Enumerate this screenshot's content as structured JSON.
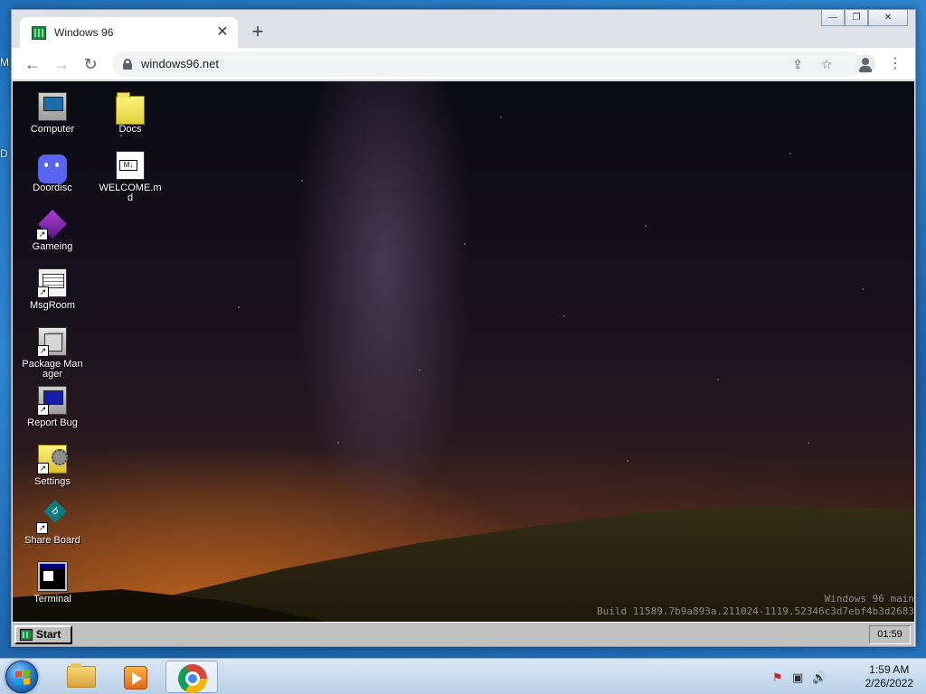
{
  "host_edge": {
    "top_letter": "M",
    "mid_letter": "D"
  },
  "browser": {
    "tab_title": "Windows 96",
    "tab_close": "✕",
    "new_tab": "+",
    "window_controls": {
      "minimize": "—",
      "restore": "❐",
      "close": "✕"
    },
    "nav": {
      "back": "←",
      "forward": "→",
      "reload": "↻"
    },
    "url": "windows96.net",
    "share": "⇪",
    "bookmark": "☆",
    "menu": "⋮"
  },
  "win96": {
    "desktop_icons": [
      {
        "label": "Computer",
        "icon": "computer-icon"
      },
      {
        "label": "Doordisc",
        "icon": "discord-icon"
      },
      {
        "label": "Gameing",
        "icon": "cube-icon"
      },
      {
        "label": "MsgRoom",
        "icon": "msg-icon"
      },
      {
        "label": "Package Manager",
        "icon": "package-icon"
      },
      {
        "label": "Report Bug",
        "icon": "bug-icon"
      },
      {
        "label": "Settings",
        "icon": "settings-icon"
      },
      {
        "label": "Share Board",
        "icon": "board-icon"
      },
      {
        "label": "Terminal",
        "icon": "terminal-icon"
      },
      {
        "label": "Docs",
        "icon": "folder-icon"
      },
      {
        "label": "WELCOME.md",
        "icon": "document-icon"
      }
    ],
    "build_line1": "Windows 96 main",
    "build_line2": "Build 11589.7b9a893a.211024-1119.52346c3d7ebf4b3d2683",
    "start_label": "Start",
    "clock": "01:59"
  },
  "host_taskbar": {
    "time": "1:59 AM",
    "date": "2/26/2022"
  }
}
